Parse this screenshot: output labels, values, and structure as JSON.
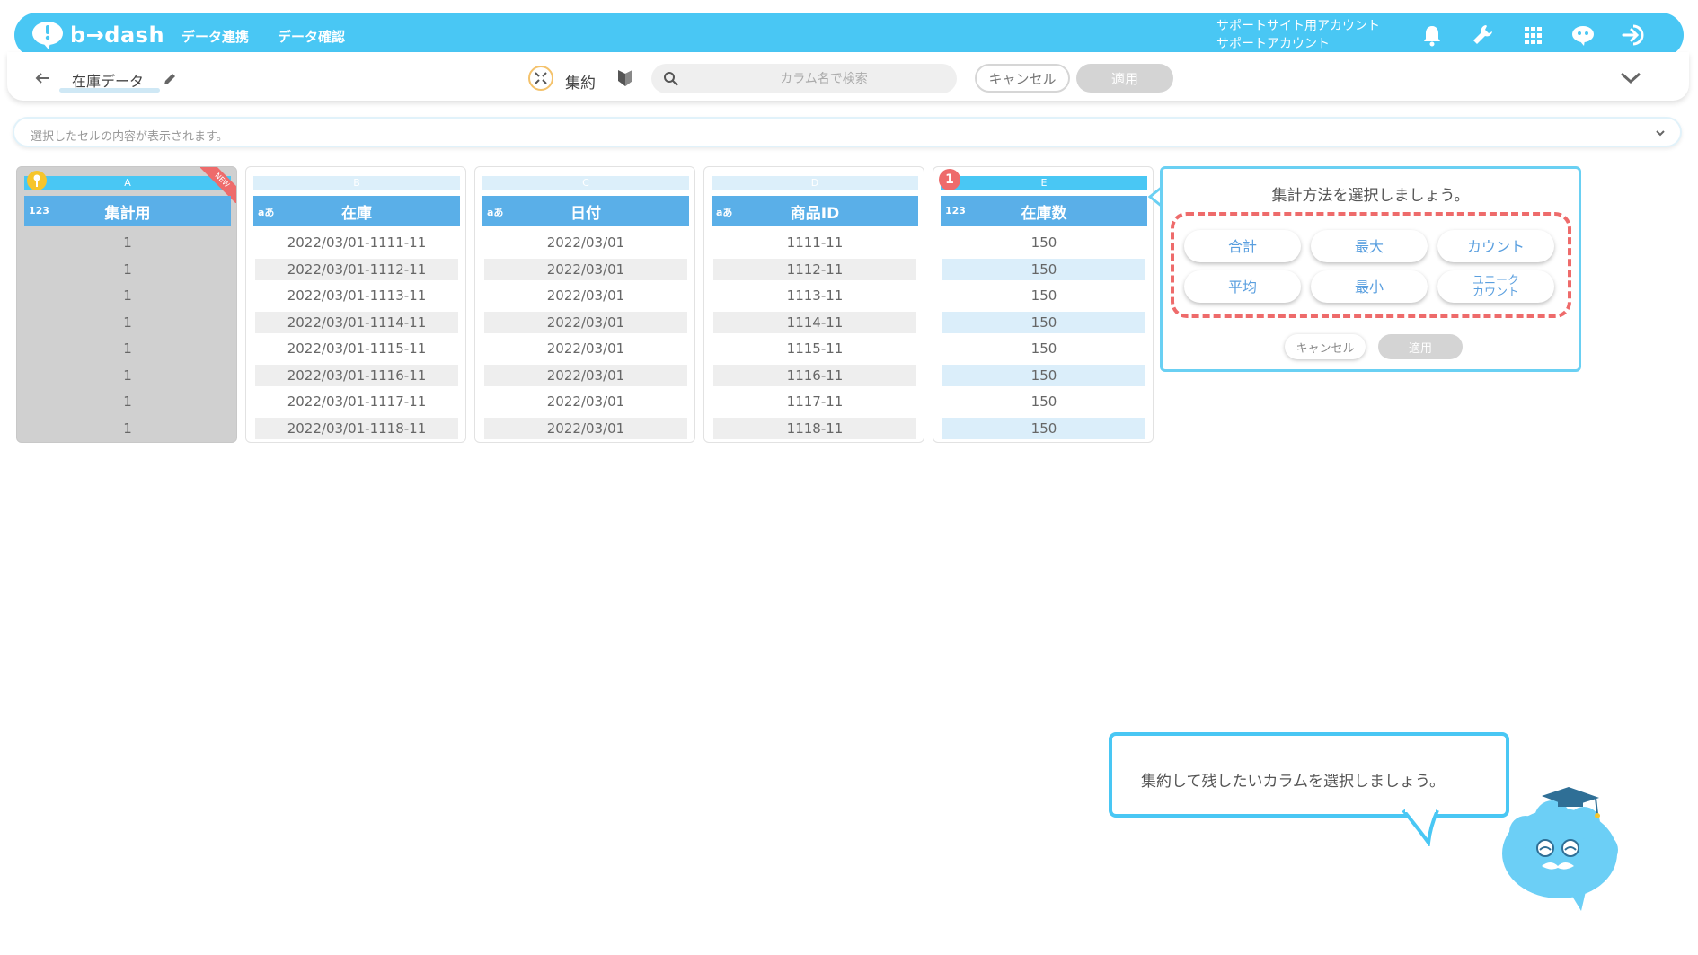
{
  "header": {
    "logo_text": "b→dash",
    "nav": [
      "データ連携",
      "データ確認"
    ],
    "account_line1": "サポートサイト用アカウント",
    "account_line2": "サポートアカウント",
    "icons": [
      "bell-icon",
      "wrench-icon",
      "grid-icon",
      "chat-bot-icon",
      "logout-icon"
    ]
  },
  "toolbar": {
    "file_name": "在庫データ",
    "mode_label": "集約",
    "search_placeholder": "カラム名で検索",
    "cancel_label": "キャンセル",
    "apply_label": "適用"
  },
  "cell_bar": {
    "placeholder": "選択したセルの内容が表示されます。"
  },
  "table": {
    "columns": [
      {
        "letter": "A",
        "type": "123",
        "name": "集計用",
        "values": [
          "1",
          "1",
          "1",
          "1",
          "1",
          "1",
          "1",
          "1"
        ]
      },
      {
        "letter": "B",
        "type": "aあ",
        "name": "在庫",
        "values": [
          "2022/03/01-1111-11",
          "2022/03/01-1112-11",
          "2022/03/01-1113-11",
          "2022/03/01-1114-11",
          "2022/03/01-1115-11",
          "2022/03/01-1116-11",
          "2022/03/01-1117-11",
          "2022/03/01-1118-11"
        ]
      },
      {
        "letter": "C",
        "type": "aあ",
        "name": "日付",
        "values": [
          "2022/03/01",
          "2022/03/01",
          "2022/03/01",
          "2022/03/01",
          "2022/03/01",
          "2022/03/01",
          "2022/03/01",
          "2022/03/01"
        ]
      },
      {
        "letter": "D",
        "type": "aあ",
        "name": "商品ID",
        "values": [
          "1111-11",
          "1112-11",
          "1113-11",
          "1114-11",
          "1115-11",
          "1116-11",
          "1117-11",
          "1118-11"
        ]
      },
      {
        "letter": "E",
        "type": "123",
        "name": "在庫数",
        "values": [
          "150",
          "150",
          "150",
          "150",
          "150",
          "150",
          "150",
          "150"
        ]
      }
    ],
    "new_ribbon": "NEW",
    "selected_badge": "1"
  },
  "agg_popup": {
    "title": "集計方法を選択しましょう。",
    "methods": [
      "合計",
      "最大",
      "カウント",
      "平均",
      "最小",
      "ユニーク\nカウント"
    ],
    "cancel_label": "キャンセル",
    "apply_label": "適用"
  },
  "guide": {
    "message": "集約して残したいカラムを選択しましょう。"
  },
  "colors": {
    "header_bg": "#49c7f4",
    "column_header": "#5aafe8",
    "highlight_dash": "#ee6b6b",
    "disabled_button": "#d4d4d4"
  }
}
